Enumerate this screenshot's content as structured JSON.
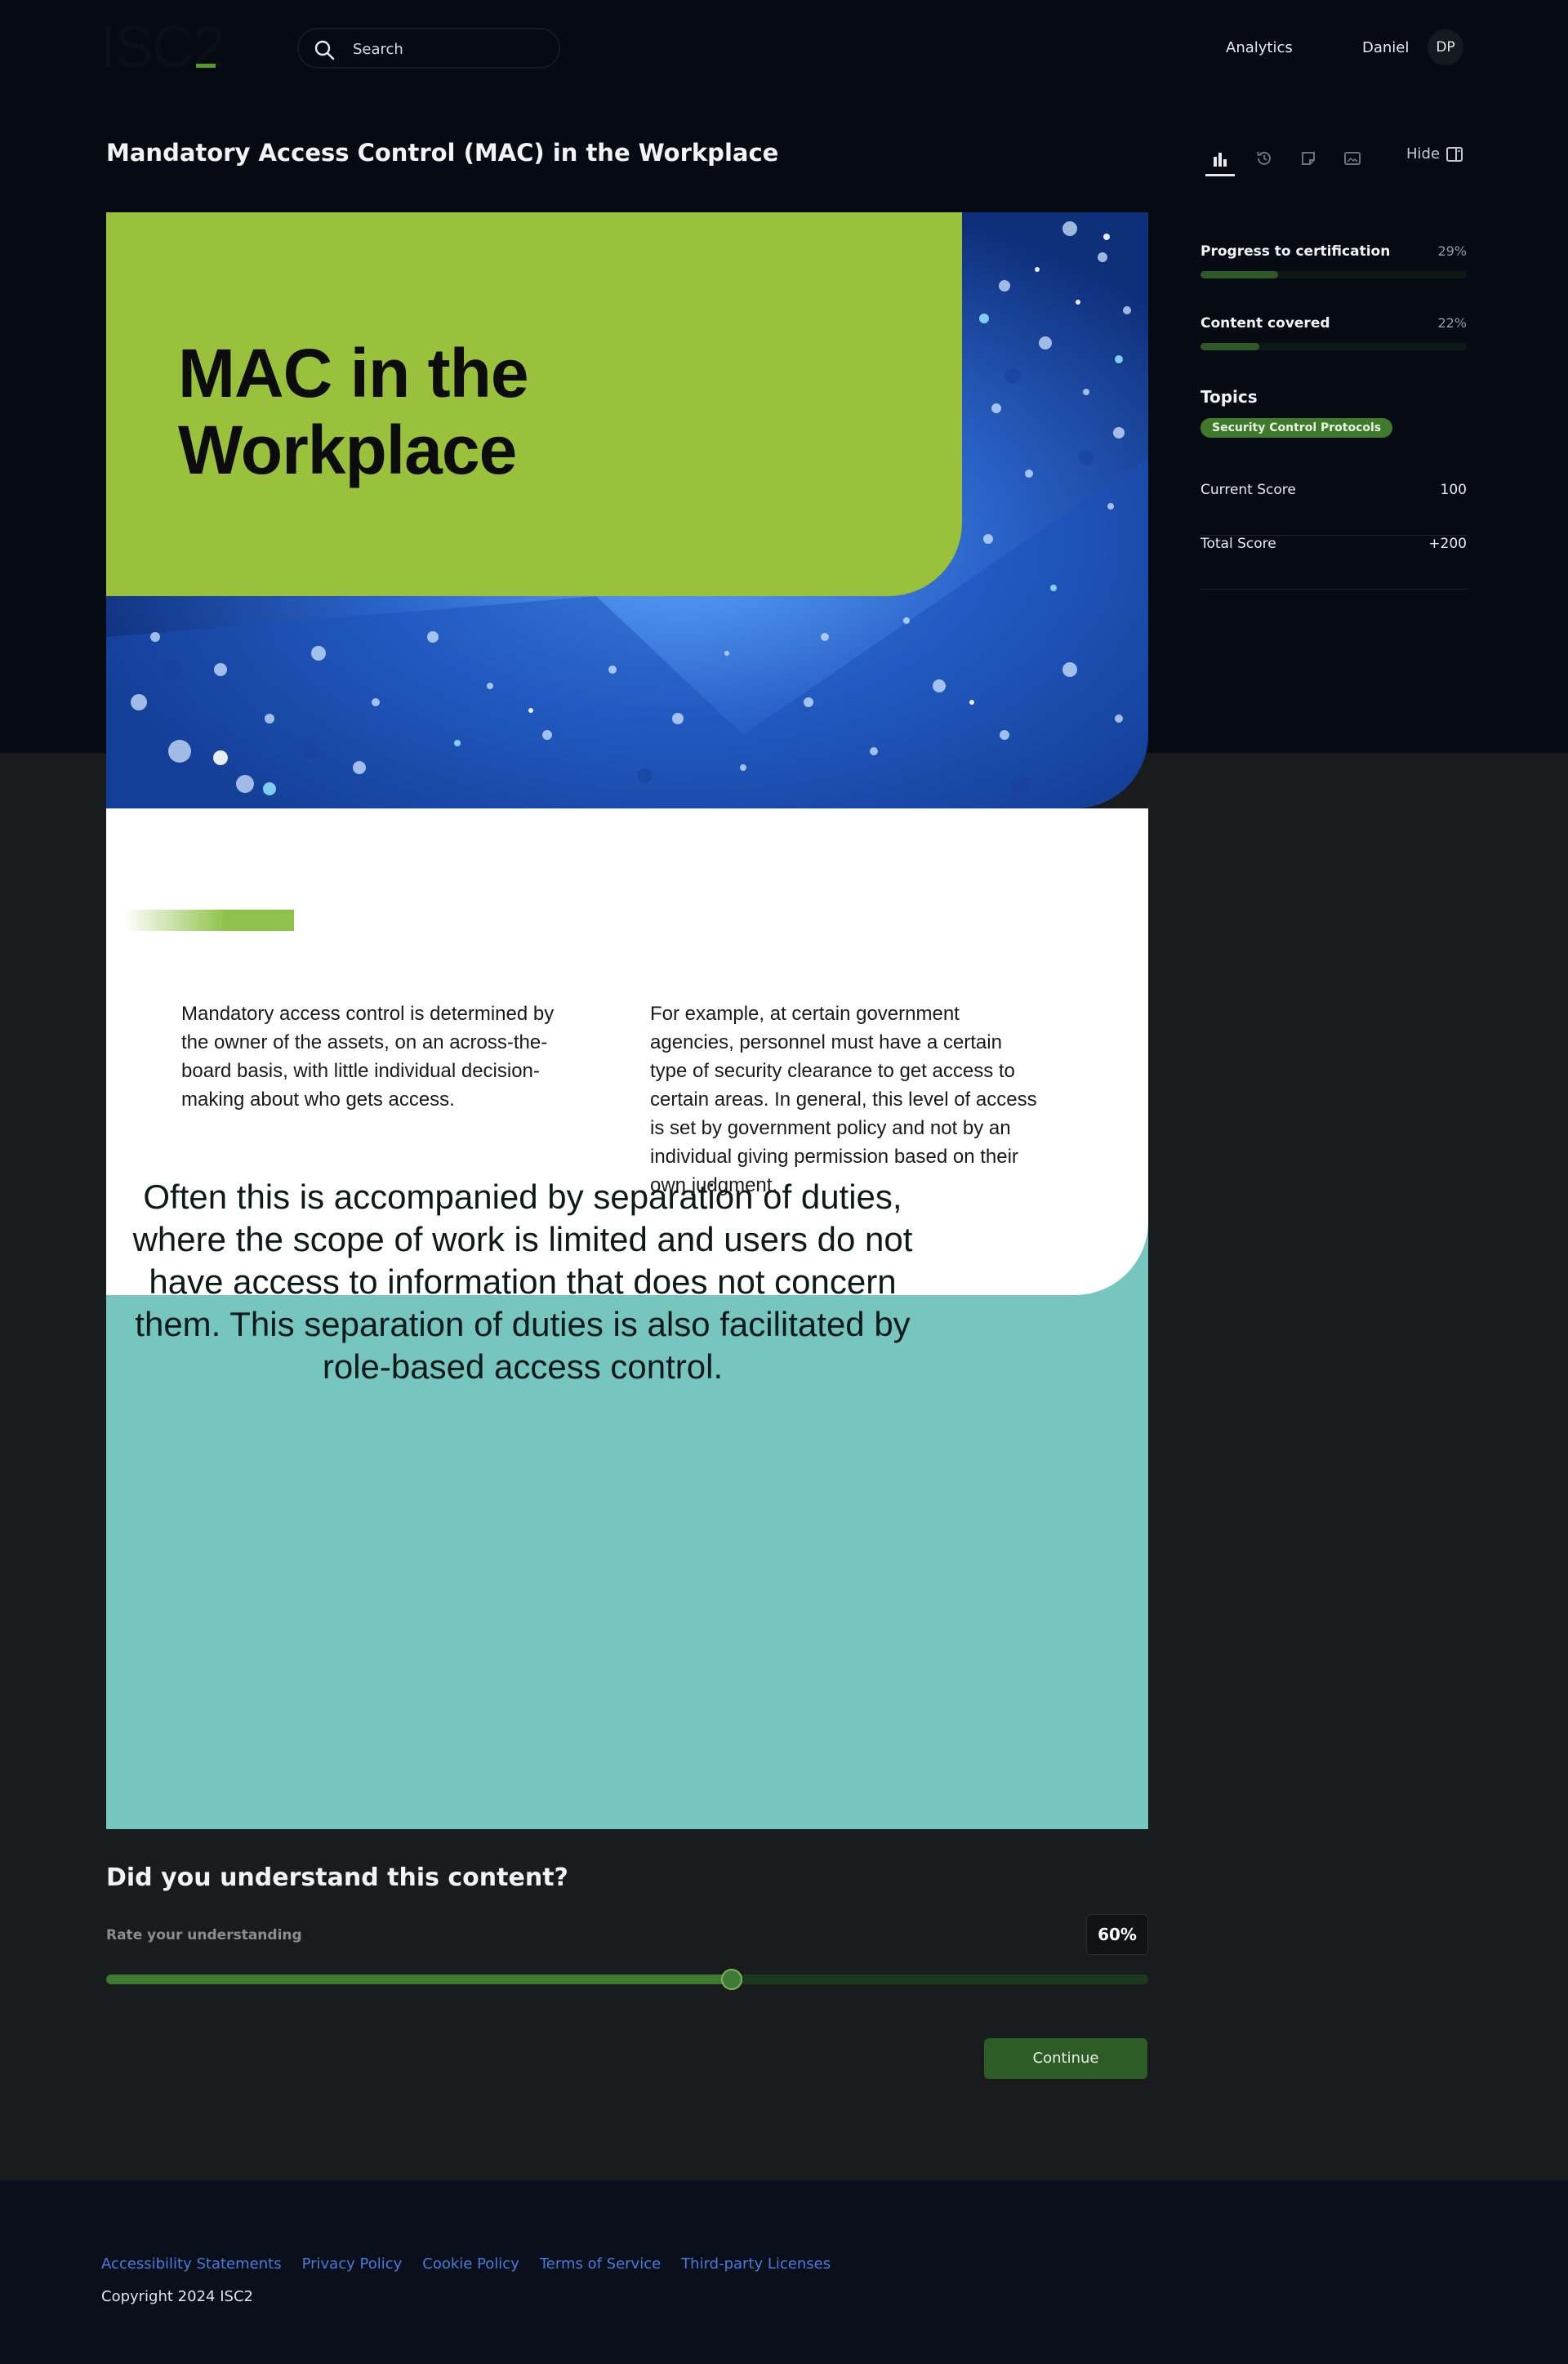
{
  "header": {
    "logo": "ISC2",
    "search_placeholder": "Search",
    "nav_analytics": "Analytics",
    "user_name": "Daniel",
    "user_initials": "DP"
  },
  "page": {
    "title": "Mandatory Access Control (MAC) in the Workplace",
    "hide_label": "Hide",
    "toolbar_icons": [
      "bar-chart-icon",
      "history-icon",
      "note-icon",
      "image-icon"
    ]
  },
  "hero": {
    "title_line1": "MAC in the",
    "title_line2": "Workplace"
  },
  "body": {
    "col1": "Mandatory access control is determined by the owner of the assets, on an across-the-board basis, with little individual decision-making about who gets access.",
    "col2": "For example, at certain government agencies, personnel must have a certain type of security clearance to get access to certain areas. In general, this level of access is set by government policy and not by an individual giving permission based on their own judgment.",
    "callout": "Often this is accompanied by separation of duties, where the scope of work is limited and users do not have access to information that does not concern them. This separation of duties is also facilitated by role-based access control."
  },
  "sidebar": {
    "progress_label": "Progress to certification",
    "progress_value": "29%",
    "progress_fraction": 0.29,
    "content_label": "Content covered",
    "content_value": "22%",
    "content_fraction": 0.22,
    "topics_heading": "Topics",
    "topic_chip": "Security Control Protocols",
    "current_score_label": "Current Score",
    "current_score_value": "100",
    "total_score_label": "Total Score",
    "total_score_value": "+200"
  },
  "understanding": {
    "heading": "Did you understand this content?",
    "rate_label": "Rate your understanding",
    "rate_value": "60%",
    "rate_fraction": 0.6,
    "continue_label": "Continue"
  },
  "footer": {
    "links": [
      "Accessibility Statements",
      "Privacy Policy",
      "Cookie Policy",
      "Terms of Service",
      "Third-party Licenses"
    ],
    "copyright": "Copyright 2024 ISC2"
  },
  "colors": {
    "hero_green": "#9ac13c",
    "teal": "#76c5bf",
    "accent_green": "#2e5c27",
    "link_blue": "#4a7bd8"
  }
}
